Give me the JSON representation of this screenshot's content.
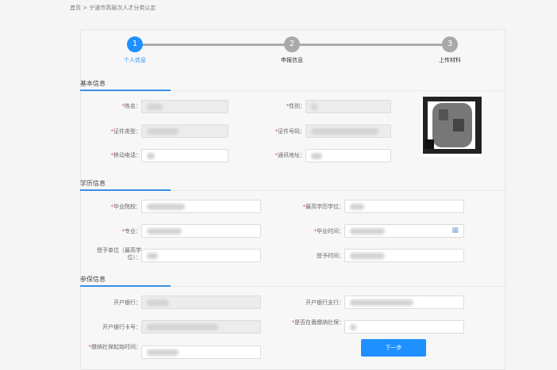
{
  "breadcrumb": {
    "home": "首页",
    "sep": ">",
    "current": "宁波市高层次人才分类认定"
  },
  "steps": [
    {
      "num": "1",
      "label": "个人信息"
    },
    {
      "num": "2",
      "label": "申报信息"
    },
    {
      "num": "3",
      "label": "上传材料"
    }
  ],
  "sections": {
    "basic": "基本信息",
    "education": "学历信息",
    "insurance": "参保信息"
  },
  "required_mark": "*",
  "fields": {
    "name": "姓名：",
    "gender": "性别：",
    "id_type": "证件类型：",
    "id_number": "证件号码：",
    "mobile": "移动电话：",
    "address": "通讯地址：",
    "school": "毕业院校：",
    "degree": "最高学历学位：",
    "major": "专业：",
    "grad_time": "毕业时间：",
    "grant_unit": "授予单位（最高学位）：",
    "grant_time": "授予时间：",
    "bank": "开户银行：",
    "bank_branch": "开户银行支行：",
    "bank_card": "开户银行卡号：",
    "ningbo_insured": "是否在甬缴纳社保：",
    "insure_start": "缴纳社保起始时间："
  },
  "buttons": {
    "next": "下一步"
  },
  "colors": {
    "accent": "#1e90ff",
    "required": "#e74c3c"
  }
}
